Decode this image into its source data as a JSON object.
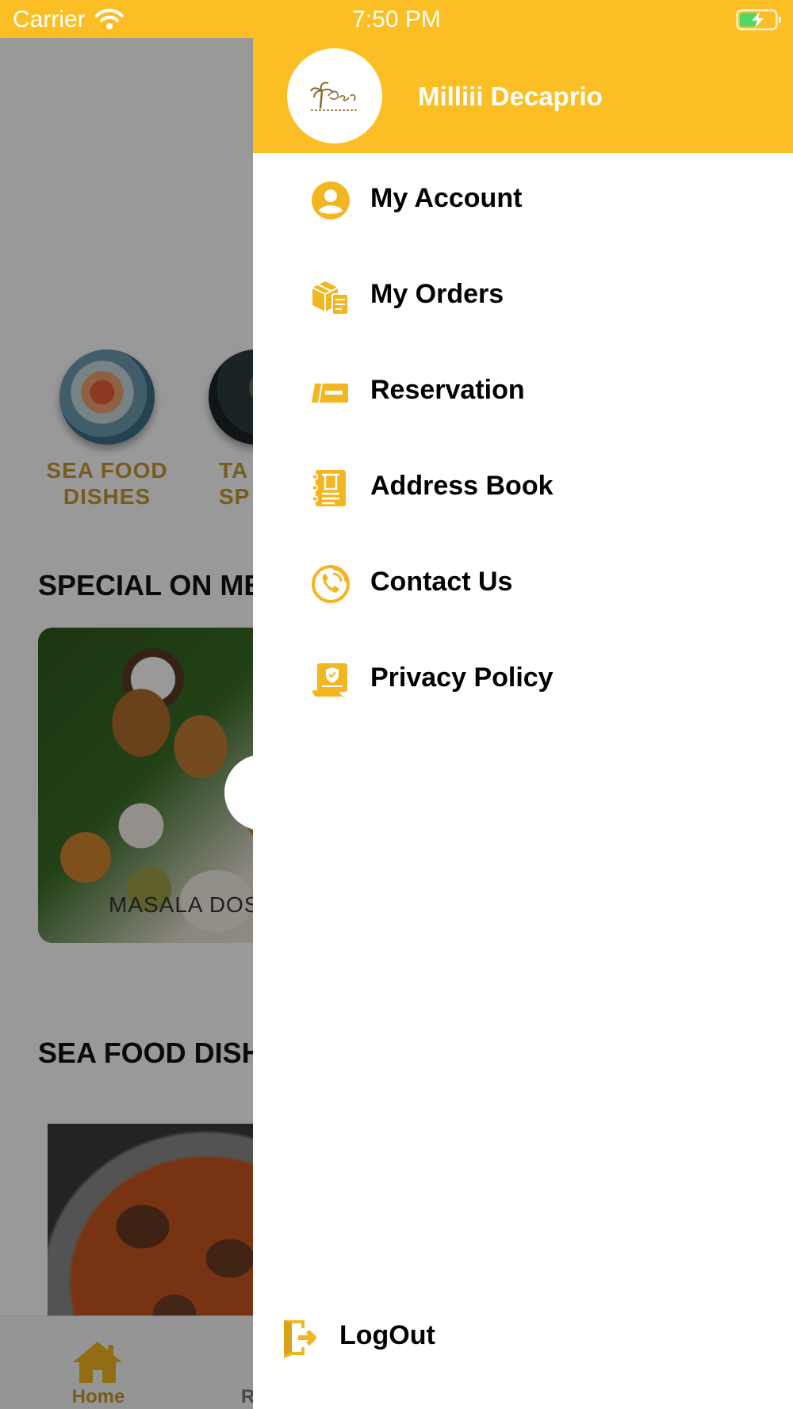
{
  "status_bar": {
    "carrier": "Carrier",
    "time": "7:50 PM"
  },
  "background": {
    "categories": [
      {
        "label_line1": "SEA FOOD",
        "label_line2": "DISHES"
      },
      {
        "label_line1": "TA",
        "label_line2": "SP"
      }
    ],
    "section_special": "SPECIAL ON ME",
    "special_caption": "MASALA DOS",
    "section_seafood": "SEA FOOD DISH",
    "tabbar": {
      "home_label": "Home",
      "second_label": "R"
    }
  },
  "drawer": {
    "user_name": "Milliii Decaprio",
    "menu": [
      {
        "label": "My Account",
        "icon": "account-icon"
      },
      {
        "label": "My Orders",
        "icon": "orders-icon"
      },
      {
        "label": "Reservation",
        "icon": "reservation-icon"
      },
      {
        "label": "Address Book",
        "icon": "address-book-icon"
      },
      {
        "label": "Contact Us",
        "icon": "contact-icon"
      },
      {
        "label": "Privacy Policy",
        "icon": "privacy-icon"
      }
    ],
    "logout_label": "LogOut"
  },
  "colors": {
    "accent": "#FBBE24",
    "icon": "#F2B620",
    "category_text": "#C69A32"
  }
}
